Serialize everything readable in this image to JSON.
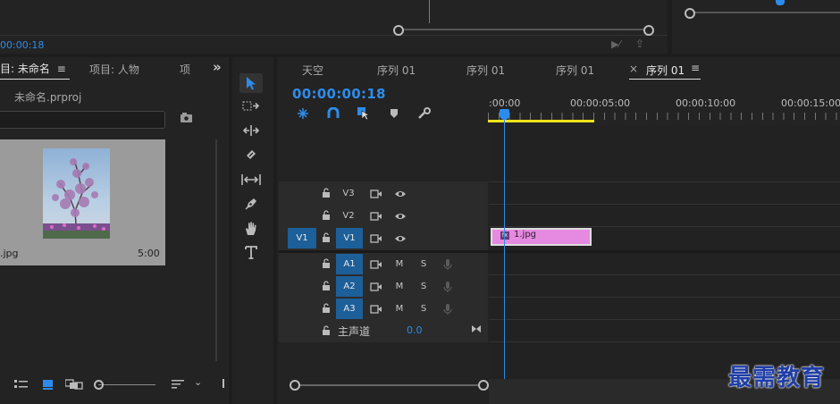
{
  "top": {
    "timecode": "00:00:18"
  },
  "project_panel": {
    "tabs": [
      "目: 未命名",
      "项目: 人物",
      "项"
    ],
    "more": "»",
    "file_name": "未命名.prproj",
    "search_value": "",
    "clip_name": ".jpg",
    "clip_duration": "5:00"
  },
  "timeline": {
    "tabs": [
      "天空",
      "序列 01",
      "序列 01",
      "序列 01",
      "序列 01"
    ],
    "close_glyph": "×",
    "timecode": "00:00:00:18",
    "ruler_labels": [
      ":00:00",
      "00:00:05:00",
      "00:00:10:00",
      "00:00:15:00"
    ],
    "video_tracks": [
      {
        "name": "V3",
        "source": ""
      },
      {
        "name": "V2",
        "source": ""
      },
      {
        "name": "V1",
        "source": "V1"
      }
    ],
    "audio_tracks": [
      {
        "name": "A1",
        "m": "M",
        "s": "S"
      },
      {
        "name": "A2",
        "m": "M",
        "s": "S"
      },
      {
        "name": "A3",
        "m": "M",
        "s": "S"
      }
    ],
    "master_label": "主声道",
    "master_value": "0.0",
    "clip_label": "1.jpg",
    "clip_color": "#e58ae0",
    "accent": "#2d8ceb"
  },
  "watermark": "最需教育"
}
